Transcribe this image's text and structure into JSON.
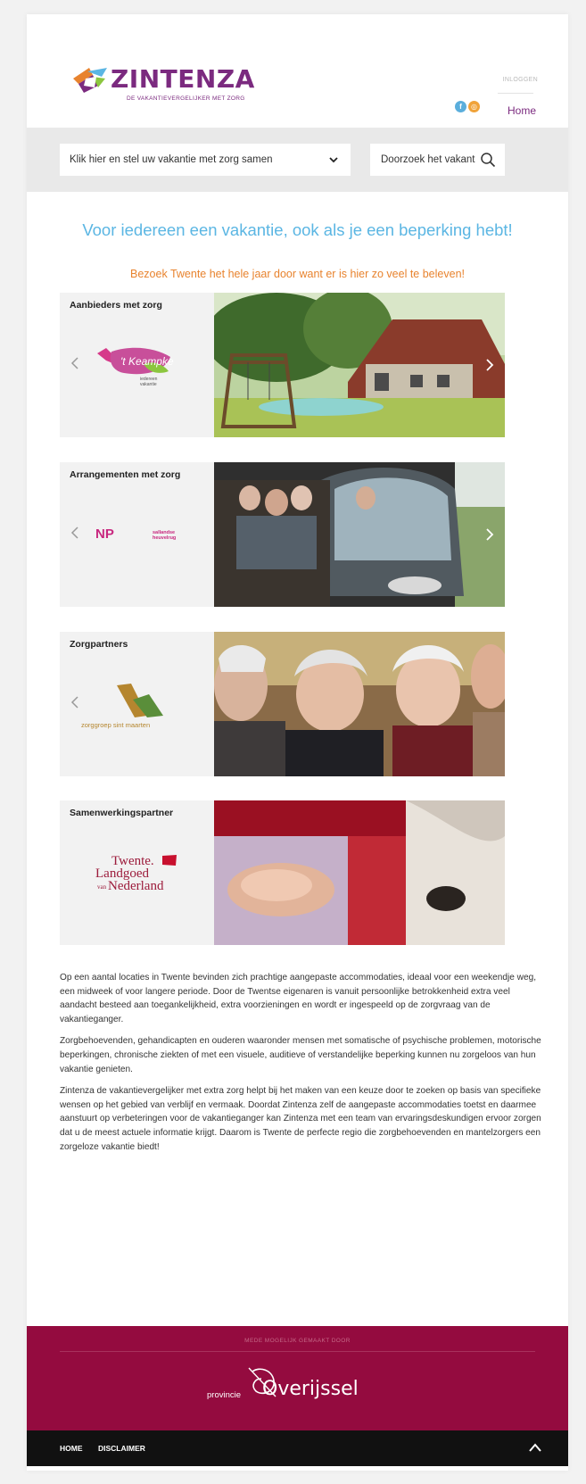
{
  "header": {
    "brand_name": "ZINTENZA",
    "brand_tagline": "DE VAKANTIEVERGELIJKER MET ZORG",
    "login_label": "INLOGGEN",
    "nav_home": "Home",
    "social_icons": [
      "facebook-icon",
      "instagram-icon"
    ]
  },
  "search_band": {
    "select_label": "Klik hier en stel uw vakantie met zorg samen",
    "search_text": "Doorzoek het vakant"
  },
  "hero": {
    "headline": "Voor iedereen een vakantie, ook als je een beperking hebt!",
    "subline": "Bezoek Twente het hele jaar door want er is hier zo veel te beleven!"
  },
  "sections": [
    {
      "title": "Aanbieders met zorg",
      "partner_logo_text": "'t Keampke",
      "partner_logo_sub": "iedereen vakantie"
    },
    {
      "title": "Arrangementen met zorg",
      "partner_logo_text": "NP",
      "partner_logo_sub": "sallandse heuvelrug"
    },
    {
      "title": "Zorgpartners",
      "partner_logo_text": "zorggroep sint maarten"
    },
    {
      "title": "Samenwerkingspartner",
      "partner_logo_text": "Twente.",
      "partner_logo_line2": "Landgoed",
      "partner_logo_line3": "Nederland",
      "partner_logo_van": "van"
    }
  ],
  "body": {
    "paragraphs": [
      "Op een aantal locaties in Twente bevinden zich prachtige aangepaste accommodaties, ideaal voor een weekendje weg, een midweek of voor langere periode. Door de Twentse eigenaren is vanuit persoonlijke betrokkenheid extra veel aandacht besteed aan toegankelijkheid, extra voorzieningen en wordt er ingespeeld op de zorgvraag van de vakantieganger.",
      "Zorgbehoevenden, gehandicapten en ouderen waaronder mensen met somatische of psychische problemen, motorische beperkingen, chronische ziekten of met een visuele, auditieve of verstandelijke beperking kunnen nu zorgeloos van hun vakantie genieten.",
      "Zintenza de vakantievergelijker met extra zorg helpt bij het maken van een keuze door te zoeken op basis van specifieke wensen op het gebied van verblijf en vermaak. Doordat Zintenza zelf de aangepaste accommodaties toetst en daarmee aanstuurt op verbeteringen voor de vakantieganger kan Zintenza met een team van ervaringsdeskundigen ervoor zorgen dat u de meest actuele informatie krijgt. Daarom is Twente de perfecte regio die zorgbehoevenden en mantelzorgers een zorgeloze vakantie biedt!"
    ]
  },
  "footer": {
    "made_by": "MEDE MOGELIJK GEMAAKT DOOR",
    "sponsor_prefix": "provincie",
    "sponsor_name": "Overijssel",
    "links": [
      "HOME",
      "DISCLAIMER"
    ]
  },
  "colors": {
    "brand_purple": "#7b2a7f",
    "headline_blue": "#5bb6e3",
    "subline_orange": "#e8832e",
    "footer_maroon": "#940b3f"
  }
}
